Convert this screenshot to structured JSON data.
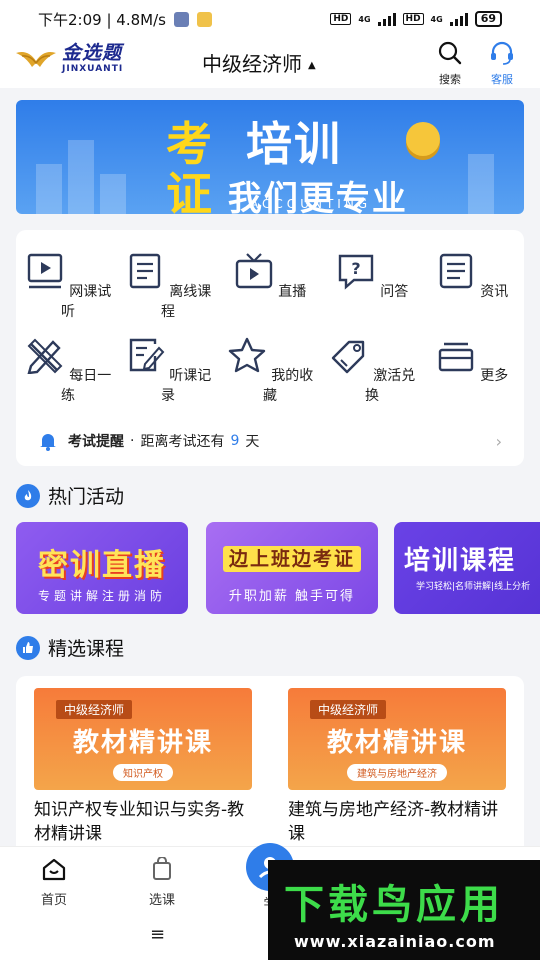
{
  "status_bar": {
    "time_speed": "下午2:09 | 4.8M/s",
    "hd1": "HD",
    "net1": "4G",
    "hd2": "HD",
    "net2": "4G",
    "battery": "69"
  },
  "header": {
    "logo_cn": "金选题",
    "logo_en": "JINXUANTI",
    "title": "中级经济师",
    "search_label": "搜索",
    "service_label": "客服"
  },
  "banner": {
    "line1_char": "考",
    "line1_text": "培训",
    "line2_char": "证",
    "line2_text": "我们更专业",
    "subtitle": "ACCOUNTING"
  },
  "grid": {
    "items": [
      {
        "label": "网课试听",
        "icon": "video-lesson-icon"
      },
      {
        "label": "离线课程",
        "icon": "offline-course-icon"
      },
      {
        "label": "直播",
        "icon": "live-tv-icon"
      },
      {
        "label": "问答",
        "icon": "question-bubble-icon"
      },
      {
        "label": "资讯",
        "icon": "news-icon"
      },
      {
        "label": "每日一练",
        "icon": "pencil-ruler-icon"
      },
      {
        "label": "听课记录",
        "icon": "record-edit-icon"
      },
      {
        "label": "我的收藏",
        "icon": "star-icon"
      },
      {
        "label": "激活兑换",
        "icon": "key-tag-icon"
      },
      {
        "label": "更多",
        "icon": "more-stack-icon"
      }
    ]
  },
  "reminder": {
    "title": "考试提醒",
    "text": "距离考试还有",
    "days": "9",
    "unit": "天"
  },
  "hot": {
    "title": "热门活动",
    "cards": [
      {
        "main": "密训直播",
        "sub": "专题讲解注册消防"
      },
      {
        "main": "边上班边考证",
        "sub": "升职加薪 触手可得"
      },
      {
        "main": "培训课程",
        "sub": "学习轻松|名师讲解|线上分析"
      }
    ]
  },
  "featured": {
    "title": "精选课程",
    "courses": [
      {
        "tag": "中级经济师",
        "thumb_title": "教材精讲课",
        "pill": "知识产权",
        "name": "知识产权专业知识与实务-教材精讲课"
      },
      {
        "tag": "中级经济师",
        "thumb_title": "教材精讲课",
        "pill": "建筑与房地产经济",
        "name": "建筑与房地产经济-教材精讲课"
      }
    ]
  },
  "tabs": {
    "home": "首页",
    "select": "选课",
    "study": "学"
  },
  "watermark": {
    "line1": "下载鸟应用",
    "line2": "www.xiazainiao.com"
  },
  "colors": {
    "accent": "#2f7de9",
    "banner_yellow": "#ffd71a",
    "course_orange": "#f67b3a"
  }
}
